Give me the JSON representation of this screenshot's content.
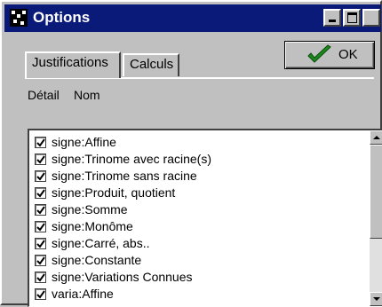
{
  "window": {
    "title": "Options"
  },
  "tabs": [
    {
      "label": "Justifications"
    },
    {
      "label": "Calculs"
    }
  ],
  "ok_button": {
    "label": "OK"
  },
  "headers": {
    "detail": "Détail",
    "name": "Nom"
  },
  "items": [
    {
      "label": "signe:Affine",
      "checked": true
    },
    {
      "label": "signe:Trinome avec racine(s)",
      "checked": true
    },
    {
      "label": "signe:Trinome sans racine",
      "checked": true
    },
    {
      "label": "signe:Produit, quotient",
      "checked": true
    },
    {
      "label": "signe:Somme",
      "checked": true
    },
    {
      "label": "signe:Monôme",
      "checked": true
    },
    {
      "label": "signe:Carré, abs..",
      "checked": true
    },
    {
      "label": "signe:Constante",
      "checked": true
    },
    {
      "label": "signe:Variations Connues",
      "checked": true
    },
    {
      "label": "varia:Affine",
      "checked": true
    }
  ],
  "colors": {
    "titlebar": "#0a1a78",
    "check_green": "#1a8a1a"
  },
  "icons": {
    "app": "app-icon",
    "minimize": "minimize-icon",
    "maximize": "maximize-icon",
    "ok": "checkmark-icon",
    "scroll_up": "arrow-up-icon",
    "scroll_down": "arrow-down-icon"
  }
}
